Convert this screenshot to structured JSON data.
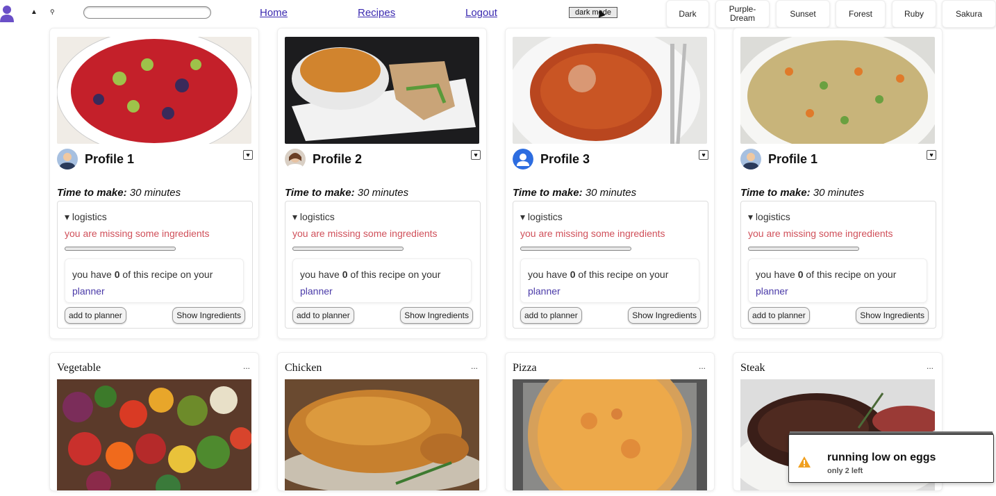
{
  "nav": {
    "links": [
      "Home",
      "Recipes",
      "Logout"
    ],
    "dark_mode_label": "dark mode",
    "themes": [
      "Dark",
      "Purple-\nDream",
      "Sunset",
      "Forest",
      "Ruby",
      "Sakura"
    ]
  },
  "search": {
    "placeholder": ""
  },
  "recipes": [
    {
      "profile": "Profile 1",
      "time_label": "Time to make:",
      "time_value": "30 minutes",
      "logistics_label": "logistics",
      "missing_text": "you are missing some ingredients",
      "progress": 0.0,
      "planner_pre": "you have ",
      "planner_count": "0",
      "planner_post": " of this recipe on your ",
      "planner_word": "planner",
      "add_label": "add to planner",
      "show_label": "Show Ingredients"
    },
    {
      "profile": "Profile 2",
      "time_label": "Time to make:",
      "time_value": "30 minutes",
      "logistics_label": "logistics",
      "missing_text": "you are missing some ingredients",
      "progress": 0.0,
      "planner_pre": "you have ",
      "planner_count": "0",
      "planner_post": " of this recipe on your ",
      "planner_word": "planner",
      "add_label": "add to planner",
      "show_label": "Show Ingredients"
    },
    {
      "profile": "Profile 3",
      "time_label": "Time to make:",
      "time_value": "30 minutes",
      "logistics_label": "logistics",
      "missing_text": "you are missing some ingredients",
      "progress": 0.0,
      "planner_pre": "you have ",
      "planner_count": "0",
      "planner_post": " of this recipe on your ",
      "planner_word": "planner",
      "add_label": "add to planner",
      "show_label": "Show Ingredients"
    },
    {
      "profile": "Profile 1",
      "time_label": "Time to make:",
      "time_value": "30 minutes",
      "logistics_label": "logistics",
      "missing_text": "you are missing some ingredients",
      "progress": 0.0,
      "planner_pre": "you have ",
      "planner_count": "0",
      "planner_post": " of this recipe on your ",
      "planner_word": "planner",
      "add_label": "add to planner",
      "show_label": "Show Ingredients"
    }
  ],
  "categories": [
    {
      "title": "Vegetable",
      "more": "..."
    },
    {
      "title": "Chicken",
      "more": "..."
    },
    {
      "title": "Pizza",
      "more": "..."
    },
    {
      "title": "Steak",
      "more": "..."
    }
  ],
  "toast": {
    "title": "running low on eggs",
    "subtitle": "only 2 left"
  },
  "colors": {
    "link": "#3b2ab0",
    "missing": "#d0505a",
    "planner_word": "#4a3aa8",
    "warning": "#f0a020"
  }
}
